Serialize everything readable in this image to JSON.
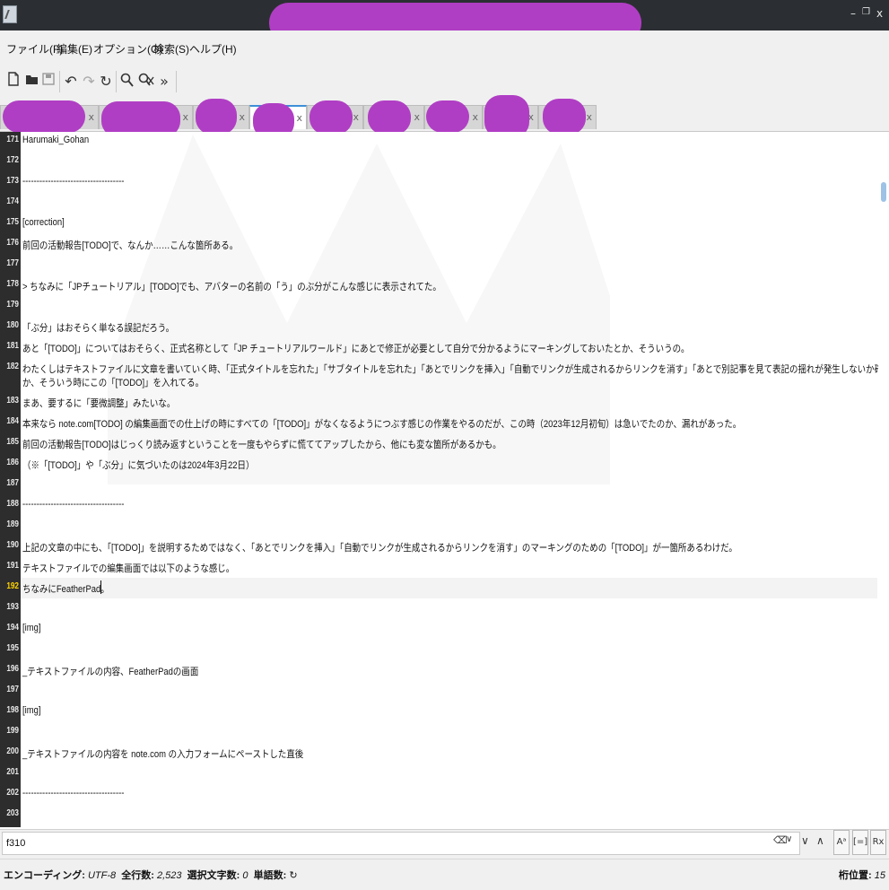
{
  "window": {
    "minimize_glyph": "–",
    "restore_glyph": "❐",
    "close_glyph": "x"
  },
  "menu": [
    {
      "label": "ファイル(F)"
    },
    {
      "label": "編集(E)"
    },
    {
      "label": "オプション(O)"
    },
    {
      "label": "検索(S)"
    },
    {
      "label": "ヘルプ(H)"
    }
  ],
  "toolbar": {
    "icons": [
      "new-file-icon",
      "open-file-icon",
      "save-icon",
      "undo-icon",
      "redo-icon",
      "reload-icon",
      "find-icon",
      "replace-icon",
      "more-icon"
    ]
  },
  "tabs": {
    "close_glyph": "x",
    "count": 10,
    "active_index": 4
  },
  "editor": {
    "lines": [
      {
        "n": "171",
        "text": "Harumaki_Gohan"
      },
      {
        "n": "172",
        "text": ""
      },
      {
        "n": "173",
        "text": "------------------------------------"
      },
      {
        "n": "174",
        "text": ""
      },
      {
        "n": "175",
        "text": "[correction]"
      },
      {
        "n": "176",
        "text": "前回の活動報告[TODO]で、なんか……こんな箇所ある。"
      },
      {
        "n": "177",
        "text": ""
      },
      {
        "n": "178",
        "text": "> ちなみに「JPチュートリアル」[TODO]でも、アバターの名前の「う」のぶ分がこんな感じに表示されてた。"
      },
      {
        "n": "179",
        "text": ""
      },
      {
        "n": "180",
        "text": "「ぶ分」はおそらく単なる誤記だろう。"
      },
      {
        "n": "181",
        "text": "あと「[TODO]」についてはおそらく、正式名称として「JP チュートリアルワールド」にあとで修正が必要として自分で分かるようにマーキングしておいたとか、そういうの。"
      },
      {
        "n": "182",
        "text": "わたくしはテキストファイルに文章を書いていく時、「正式タイトルを忘れた」「サブタイトルを忘れた」「あとでリンクを挿入」「自動でリンクが生成されるからリンクを消す」「あとで別記事を見て表記の揺れが発生しないか確認」と",
        "cont": "か、そういう時にこの「[TODO]」を入れてる。"
      },
      {
        "n": "183",
        "text": "まあ、要するに「要微調整」みたいな。"
      },
      {
        "n": "184",
        "text": "本来なら note.com[TODO] の編集画面での仕上げの時にすべての「[TODO]」がなくなるようにつぶす感じの作業をやるのだが、この時（2023年12月初旬）は急いでたのか、漏れがあった。"
      },
      {
        "n": "185",
        "text": "前回の活動報告[TODO]はじっくり読み返すということを一度もやらずに慌ててアップしたから、他にも変な箇所があるかも。"
      },
      {
        "n": "186",
        "text": "（※「[TODO]」や「ぶ分」に気づいたのは2024年3月22日）"
      },
      {
        "n": "187",
        "text": ""
      },
      {
        "n": "188",
        "text": "------------------------------------"
      },
      {
        "n": "189",
        "text": ""
      },
      {
        "n": "190",
        "text": "上記の文章の中にも、「[TODO]」を説明するためではなく、「あとでリンクを挿入」「自動でリンクが生成されるからリンクを消す」のマーキングのための「[TODO]」が一箇所あるわけだ。"
      },
      {
        "n": "191",
        "text": "テキストファイルでの編集画面では以下のような感じ。"
      },
      {
        "n": "192",
        "text": "ちなみにFeatherPad。"
      },
      {
        "n": "193",
        "text": ""
      },
      {
        "n": "194",
        "text": "[img]"
      },
      {
        "n": "195",
        "text": ""
      },
      {
        "n": "196",
        "text": "_テキストファイルの内容、FeatherPadの画面"
      },
      {
        "n": "197",
        "text": ""
      },
      {
        "n": "198",
        "text": "[img]"
      },
      {
        "n": "199",
        "text": ""
      },
      {
        "n": "200",
        "text": "_テキストファイルの内容を note.com の入力フォームにペーストした直後"
      },
      {
        "n": "201",
        "text": ""
      },
      {
        "n": "202",
        "text": "------------------------------------"
      },
      {
        "n": "203",
        "text": ""
      }
    ],
    "current_line": "192"
  },
  "find": {
    "value": "f310",
    "clear_glyph": "⌫",
    "dropdown_glyph": "∨",
    "next_glyph": "∨",
    "prev_glyph": "∧",
    "match_case": "Aᵃ",
    "whole_word": "[=]",
    "regex": "Rx"
  },
  "status": {
    "encoding_label": "エンコーディング:",
    "encoding_value": "UTF-8",
    "lines_label": "全行数:",
    "lines_value": "2,523",
    "sel_label": "選択文字数:",
    "sel_value": "0",
    "words_label": "単語数:",
    "words_refresh": "↻",
    "col_label": "桁位置:",
    "col_value": "15"
  },
  "colors": {
    "titlebar": "#2b2f33",
    "gutter": "#2d2d2d",
    "redaction": "#b03ec4",
    "active_tab_accent": "#3d8fd6"
  }
}
